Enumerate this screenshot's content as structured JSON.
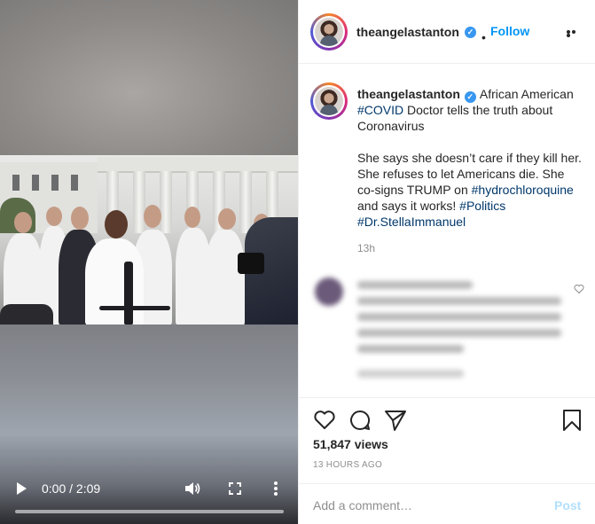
{
  "post": {
    "username": "theangelastanton",
    "verified": true,
    "follow_label": "Follow",
    "separator": "•"
  },
  "caption": {
    "username": "theangelastanton",
    "line1_text": "African American",
    "line1_tag": "#COVID",
    "line1_rest": "Doctor tells the truth about Coronavirus",
    "para2_text": "She says she doesn’t care if they kill her. She refuses to let Americans die. She co-signs TRUMP on",
    "para2_tag": "#hydrochloroquine",
    "para2_rest": "and says it works!",
    "tag_politics": "#Politics",
    "tag_doctor": "#Dr.StellaImmanuel",
    "time": "13h"
  },
  "video": {
    "time_display": "0:00 / 2:09",
    "progress_fraction": 0.0
  },
  "stats": {
    "views": "51,847 views",
    "posted_ago": "13 HOURS AGO"
  },
  "comment": {
    "placeholder": "Add a comment…",
    "post_label": "Post"
  },
  "icons": {
    "play": "play-icon",
    "volume": "volume-icon",
    "fullscreen": "fullscreen-icon",
    "more": "more-icon",
    "like": "heart-icon",
    "comment": "comment-icon",
    "share": "paper-plane-icon",
    "save": "bookmark-icon"
  },
  "colors": {
    "link_blue": "#0095f6",
    "hashtag": "#00376b",
    "verified": "#3897f0",
    "muted": "#8e8e8e",
    "post_disabled": "#b2dffc"
  }
}
